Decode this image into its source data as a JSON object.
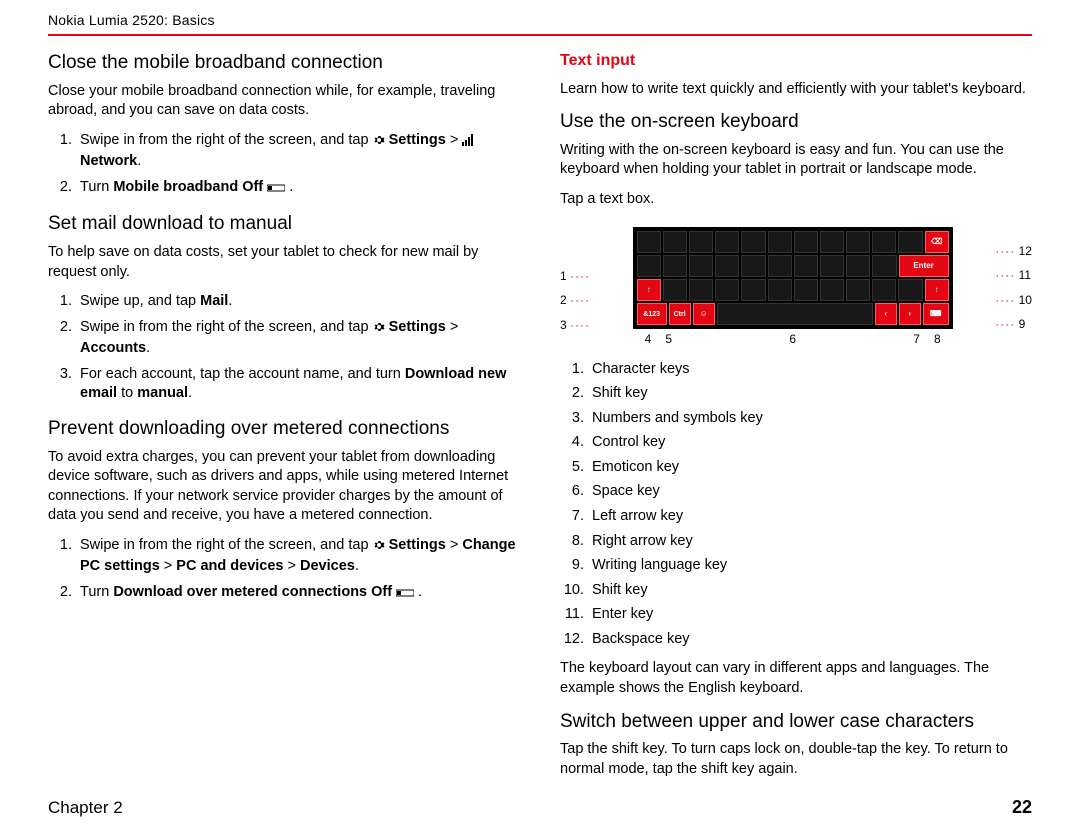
{
  "header": {
    "title": "Nokia Lumia 2520: Basics"
  },
  "left": {
    "h1": "Close the mobile broadband connection",
    "p1": "Close your mobile broadband connection while, for example, traveling abroad, and you can save on data costs.",
    "s1a_pre": "Swipe in from the right of the screen, and tap ",
    "s1a_b1": "Settings",
    "s1a_b1_post": " > ",
    "s1a_b2": "Network",
    "s1a_b2_post": ".",
    "s1b_pre": "Turn ",
    "s1b_b": "Mobile broadband Off",
    "s1b_post": " .",
    "h2": "Set mail download to manual",
    "p2": "To help save on data costs, set your tablet to check for new mail by request only.",
    "s2a_pre": "Swipe up, and tap ",
    "s2a_b": "Mail",
    "s2a_post": ".",
    "s2b_pre": "Swipe in from the right of the screen, and tap ",
    "s2b_b1": "Settings",
    "s2b_b1_post": " > ",
    "s2b_b2": "Accounts",
    "s2b_b2_post": ".",
    "s2c_pre": "For each account, tap the account name, and turn ",
    "s2c_b1": "Download new email",
    "s2c_mid": " to ",
    "s2c_b2": "manual",
    "s2c_post": ".",
    "h3": "Prevent downloading over metered connections",
    "p3": "To avoid extra charges, you can prevent your tablet from downloading device software, such as drivers and apps, while using metered Internet connections. If your network service provider charges by the amount of data you send and receive, you have a metered connection.",
    "s3a_pre": "Swipe in from the right of the screen, and tap ",
    "s3a_b1": "Settings",
    "s3a_b1_post": " > ",
    "s3a_b2": "Change PC settings",
    "s3a_mid1": " > ",
    "s3a_b3": "PC and devices",
    "s3a_mid2": " > ",
    "s3a_b4": "Devices",
    "s3a_post": ".",
    "s3b_pre": "Turn ",
    "s3b_b": "Download over metered connections Off",
    "s3b_post": " ."
  },
  "right": {
    "h_red": "Text input",
    "p_red": "Learn how to write text quickly and efficiently with your tablet's keyboard.",
    "h1": "Use the on-screen keyboard",
    "p1": "Writing with the on-screen keyboard is easy and fun. You can use the keyboard when holding your tablet in portrait or landscape mode.",
    "p2": "Tap a text box.",
    "kbd_labels_left": [
      "1",
      "2",
      "3"
    ],
    "kbd_labels_right": [
      "12",
      "11",
      "10",
      "9"
    ],
    "kbd_labels_bottom": [
      "4",
      "5",
      "6",
      "7",
      "8"
    ],
    "kbd_keys": {
      "and123": "&123",
      "ctrl": "Ctrl",
      "emoji": "☺",
      "enter": "Enter",
      "left": "‹",
      "right": "›",
      "lang": "⌨",
      "shift": "↑",
      "back": "⌫"
    },
    "legend": [
      "Character keys",
      "Shift key",
      "Numbers and symbols key",
      "Control key",
      "Emoticon key",
      "Space key",
      "Left arrow key",
      "Right arrow key",
      "Writing language key",
      "Shift key",
      "Enter key",
      "Backspace key"
    ],
    "p3": "The keyboard layout can vary in different apps and languages. The example shows the English keyboard.",
    "h2": "Switch between upper and lower case characters",
    "p4": "Tap the shift key. To turn caps lock on, double-tap the key. To return to normal mode, tap the shift key again."
  },
  "footer": {
    "chapter": "Chapter 2",
    "page": "22"
  }
}
